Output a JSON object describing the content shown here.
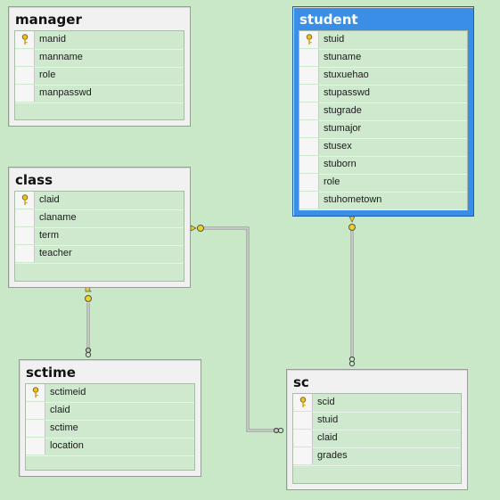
{
  "tables": {
    "manager": {
      "title": "manager",
      "columns": [
        "manid",
        "manname",
        "role",
        "manpasswd"
      ]
    },
    "student": {
      "title": "student",
      "columns": [
        "stuid",
        "stuname",
        "stuxuehao",
        "stupasswd",
        "stugrade",
        "stumajor",
        "stusex",
        "stuborn",
        "role",
        "stuhometown"
      ]
    },
    "class": {
      "title": "class",
      "columns": [
        "claid",
        "claname",
        "term",
        "teacher"
      ]
    },
    "sctime": {
      "title": "sctime",
      "columns": [
        "sctimeid",
        "claid",
        "sctime",
        "location"
      ]
    },
    "sc": {
      "title": "sc",
      "columns": [
        "scid",
        "stuid",
        "claid",
        "grades"
      ]
    }
  },
  "colors": {
    "background": "#c8e8c8",
    "selected_table": "#3a8ee6",
    "key_icon": "#f0c020"
  }
}
